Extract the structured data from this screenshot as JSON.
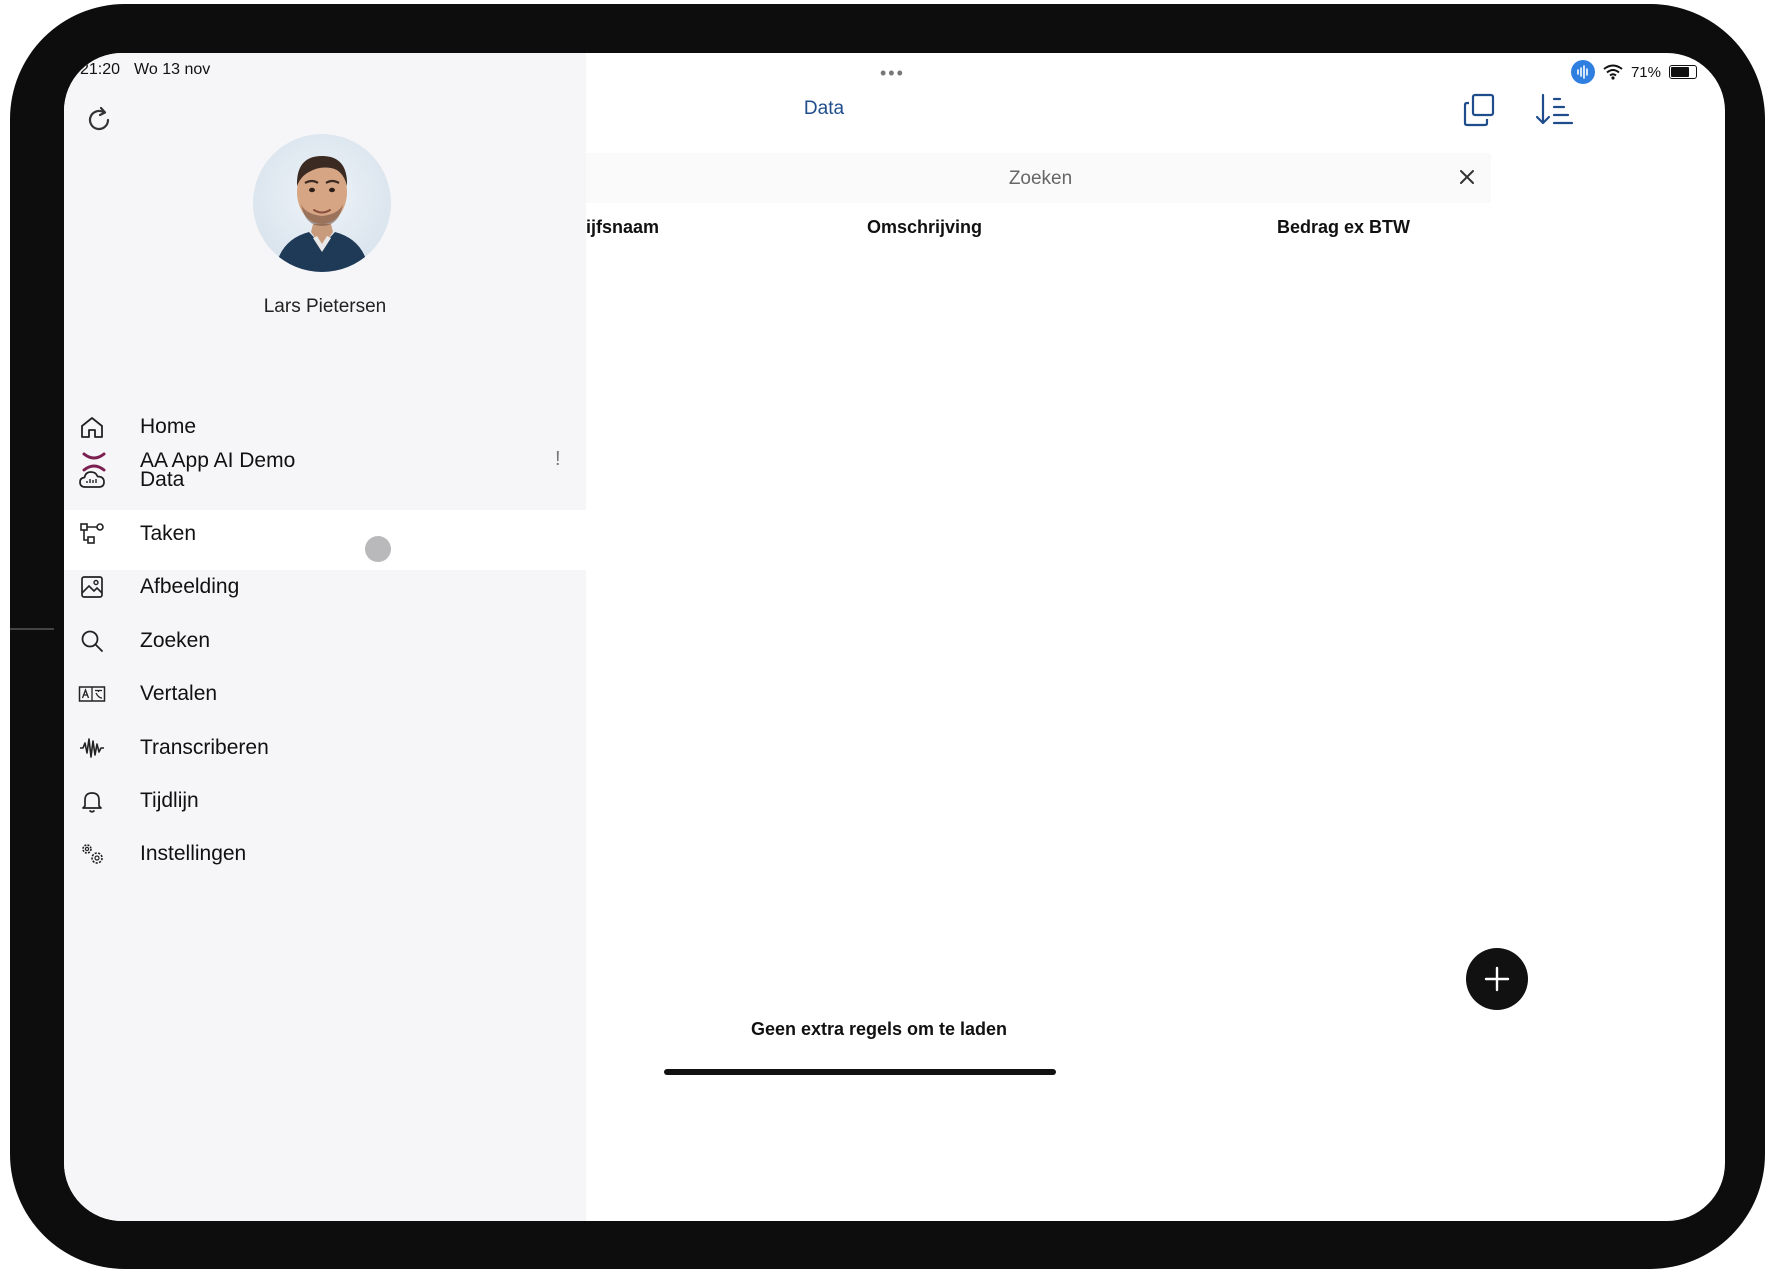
{
  "status_bar": {
    "time": "21:20",
    "date": "Wo 13 nov",
    "battery": "71%",
    "battery_level": 0.71
  },
  "drawer": {
    "user_name": "Lars Pietersen",
    "app_name": "AA App AI Demo",
    "app_indicator": "!",
    "items": [
      {
        "label": "Home",
        "icon": "home-icon"
      },
      {
        "label": "Data",
        "icon": "cloud-data-icon",
        "selected": true
      },
      {
        "label": "Taken",
        "icon": "workflow-icon"
      },
      {
        "label": "Afbeelding",
        "icon": "image-icon"
      },
      {
        "label": "Zoeken",
        "icon": "search-icon"
      },
      {
        "label": "Vertalen",
        "icon": "translate-icon"
      },
      {
        "label": "Transcriberen",
        "icon": "waveform-icon"
      },
      {
        "label": "Tijdlijn",
        "icon": "bell-icon"
      },
      {
        "label": "Instellingen",
        "icon": "gears-icon"
      }
    ]
  },
  "header": {
    "title": "Data"
  },
  "search": {
    "placeholder": "Zoeken"
  },
  "table": {
    "columns": [
      "ijfsnaam",
      "Omschrijving",
      "Bedrag ex BTW"
    ]
  },
  "footer": {
    "message": "Geen extra regels om te laden"
  },
  "colors": {
    "accent": "#1f4d8c",
    "drawer_bg": "#f6f6f8",
    "app_logo": "#7a1f4f",
    "mic_pill": "#2f7fe0"
  }
}
